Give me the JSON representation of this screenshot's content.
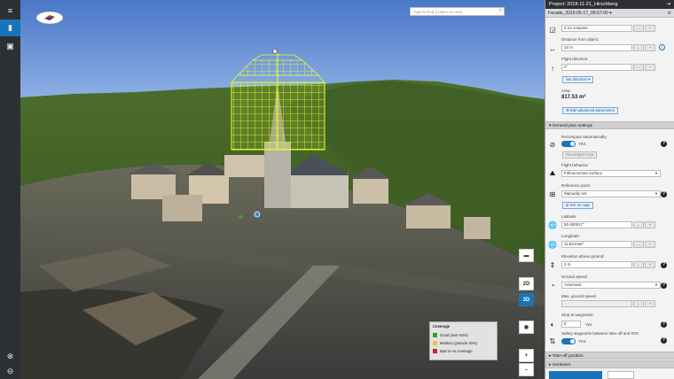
{
  "left_toolbar": {
    "items": [
      {
        "name": "menu",
        "glyph": "≡"
      },
      {
        "name": "mission",
        "glyph": "▮"
      },
      {
        "name": "layers",
        "glyph": "▣"
      }
    ],
    "bottom": [
      {
        "name": "help",
        "glyph": "⊗"
      },
      {
        "name": "user",
        "glyph": "⊖"
      }
    ]
  },
  "map": {
    "search_placeholder": "Type to find a place on map",
    "view_2d": "2D",
    "view_3d": "3D",
    "zoom_in": "+",
    "zoom_out": "–",
    "legend": {
      "title": "Coverage",
      "items": [
        {
          "label": "Good (over 60%)",
          "color": "#3a9a3a"
        },
        {
          "label": "Medium (pseudo 40%)",
          "color": "#e8c630"
        },
        {
          "label": "Bad or no coverage",
          "color": "#c62828"
        }
      ]
    }
  },
  "panel": {
    "project_title": "Project: 2018-11-21_Hirschberg",
    "plan_name": "Facade_2019-05-17_09-57-00",
    "gsd_value": "0.14 cm/pixel",
    "distance_label": "Distance from object:",
    "distance_value": "10 m",
    "direction_label": "Flight direction:",
    "direction_value": "0°",
    "set_direction": "Set direction",
    "area_label": "Area:",
    "area_value": "817.53 m²",
    "edit_advanced": "Edit advanced parameters",
    "general_section": "General plan settings",
    "recompute_label": "Recompute automatically:",
    "recompute_toggle": "YES",
    "recompute_btn": "Recompute now",
    "behavior_label": "Flight behavior:",
    "behavior_value": "Follow terrain surface",
    "refpoint_label": "Reference point:",
    "refpoint_value": "Manually set",
    "set_on_map": "Set on map",
    "latitude_label": "Latitude:",
    "latitude_value": "50.400017°",
    "longitude_label": "Longitude:",
    "longitude_value": "11.821438°",
    "elevation_label": "Elevation above ground:",
    "elevation_value": "0 m",
    "speed_label": "Ground speed:",
    "speed_value": "Automatic",
    "maxspeed_label": "Max. ground speed:",
    "maxspeed_value": "",
    "stop_label": "Stop at waypoints:",
    "stop_value": "0",
    "stop_unit": "Yes",
    "safety_label": "Safety waypoints between take-off and ROI:",
    "safety_toggle": "YES",
    "takeoff_section": "Take-off position",
    "hardware_section": "Hardware"
  }
}
